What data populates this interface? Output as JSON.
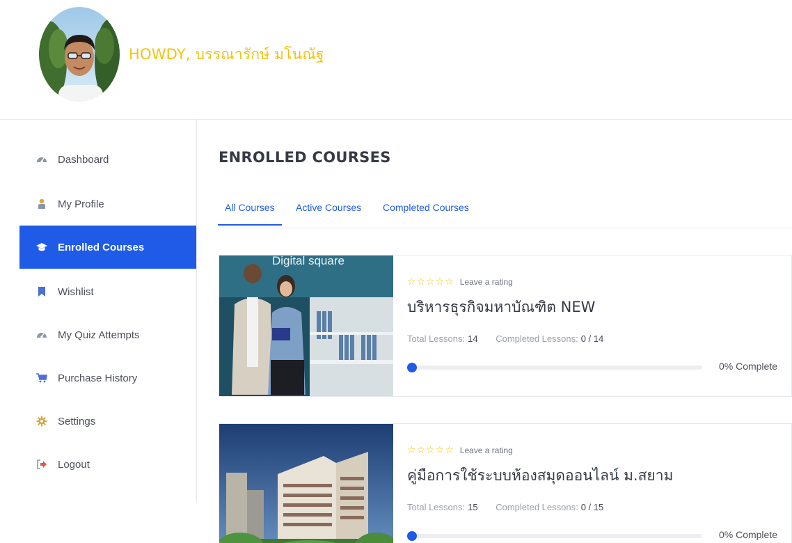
{
  "user": {
    "greeting": "HOWDY, บรรณารักษ์ มโนณัฐ"
  },
  "sidebar": {
    "items": [
      {
        "label": "Dashboard",
        "icon": "dashboard-icon"
      },
      {
        "label": "My Profile",
        "icon": "user-icon"
      },
      {
        "label": "Enrolled Courses",
        "icon": "graduation-cap-icon"
      },
      {
        "label": "Wishlist",
        "icon": "bookmark-icon"
      },
      {
        "label": "My Quiz Attempts",
        "icon": "dashboard-icon"
      },
      {
        "label": "Purchase History",
        "icon": "cart-icon"
      },
      {
        "label": "Settings",
        "icon": "gear-icon"
      },
      {
        "label": "Logout",
        "icon": "logout-icon"
      }
    ],
    "active_index": 2
  },
  "main": {
    "title": "ENROLLED COURSES",
    "tabs": [
      {
        "label": "All Courses"
      },
      {
        "label": "Active Courses"
      },
      {
        "label": "Completed Courses"
      }
    ],
    "active_tab": 0
  },
  "courses": [
    {
      "stars": "☆☆☆☆☆",
      "rating_label": "Leave a rating",
      "title": "บริหารธุรกิจมหาบัณฑิต NEW",
      "total_label": "Total Lessons:",
      "total_value": "14",
      "completed_label": "Completed Lessons:",
      "completed_value": "0 / 14",
      "progress_label": "0% Complete",
      "progress": 0,
      "thumb_caption": "Digital square"
    },
    {
      "stars": "☆☆☆☆☆",
      "rating_label": "Leave a rating",
      "title": "คู่มือการใช้ระบบห้องสมุดออนไลน์ ม.สยาม",
      "total_label": "Total Lessons:",
      "total_value": "15",
      "completed_label": "Completed Lessons:",
      "completed_value": "0 / 15",
      "progress_label": "0% Complete",
      "progress": 0
    }
  ],
  "colors": {
    "accent": "#1f5be6",
    "greeting": "#f1c40f",
    "star": "#f1c40f"
  }
}
